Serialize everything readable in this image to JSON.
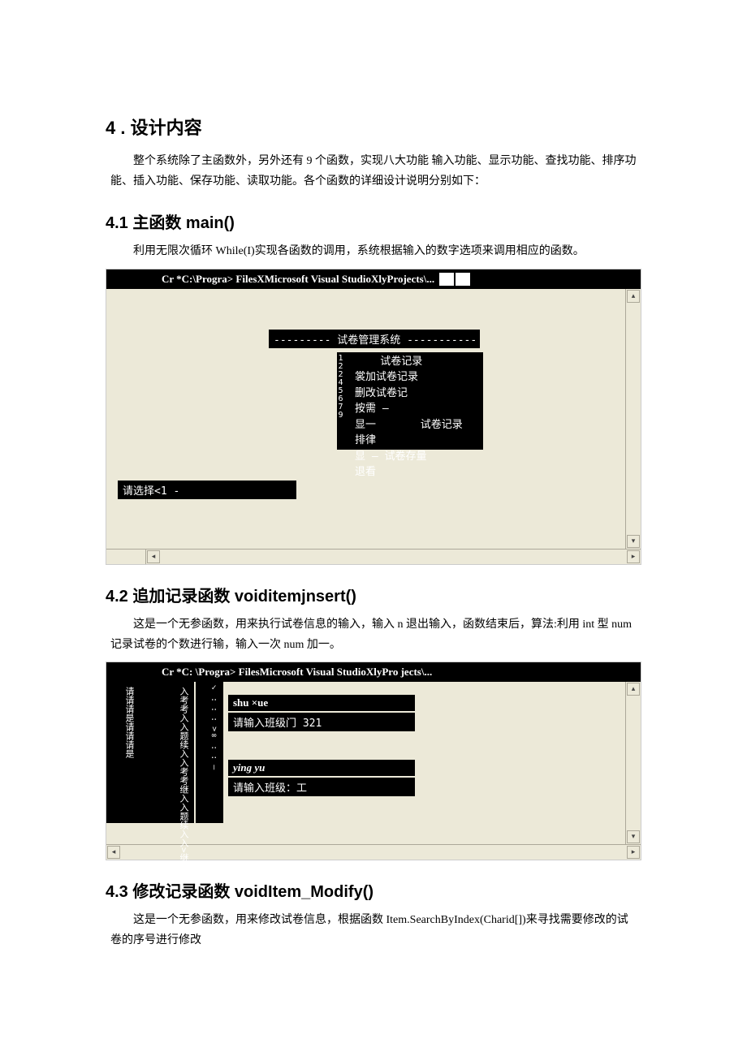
{
  "section4": {
    "number_title": "4 . 设计内容",
    "intro": "整个系统除了主函数外，另外还有 9 个函数，实现八大功能 输入功能、显示功能、查找功能、排序功能、插入功能、保存功能、读取功能。各个函数的详细设计说明分别如下："
  },
  "s41": {
    "title": "4.1 主函数 main()",
    "para": "利用无限次循环 While(I)实现各函数的调用，系统根据输入的数字选项来调用相应的函数。",
    "console": {
      "titlebar": "Cr *C:\\Progra> FilesXMicrosoft Visual StudioXlyProjects\\...",
      "menu_header": "--------- 试卷管理系统 -----------",
      "numbers_col": "12245679",
      "menu_lines": "    试卷记录\n裳加试卷记录\n删改试卷记\n按需 —\n显一       试卷记录\n排律\n显 — 试卷存量\n退看",
      "choose": "请选择<1 -"
    }
  },
  "s42": {
    "title": "4.2 追加记录函数 voiditemjnsert()",
    "para": "这是一个无参函数，用来执行试卷信息的输入，输入 n 退出输入，函数结束后，算法:利用 int 型 num 记录试卷的个数进行输，输入一次 num 加一。",
    "console": {
      "titlebar": "Cr *C: \\Progra> FilesMicrosoft Visual StudioXlyPro jects\\...",
      "left_col": "请请请是请请请是",
      "mid_col": "入考考入入题续入入考考继入入题续入入>继",
      "mid2_col": "✓ : : : >∞ : : —",
      "line1": "shu ×ue",
      "line2": "请输入班级门 321",
      "line3": "ying yu",
      "line4": "请输入班级：工"
    }
  },
  "s43": {
    "title": "4.3 修改记录函数 voidItem_Modify()",
    "para": "这是一个无参函数，用来修改试卷信息，根据函数 Item.SearchByIndex(Charid[])来寻找需要修改的试卷的序号进行修改"
  }
}
